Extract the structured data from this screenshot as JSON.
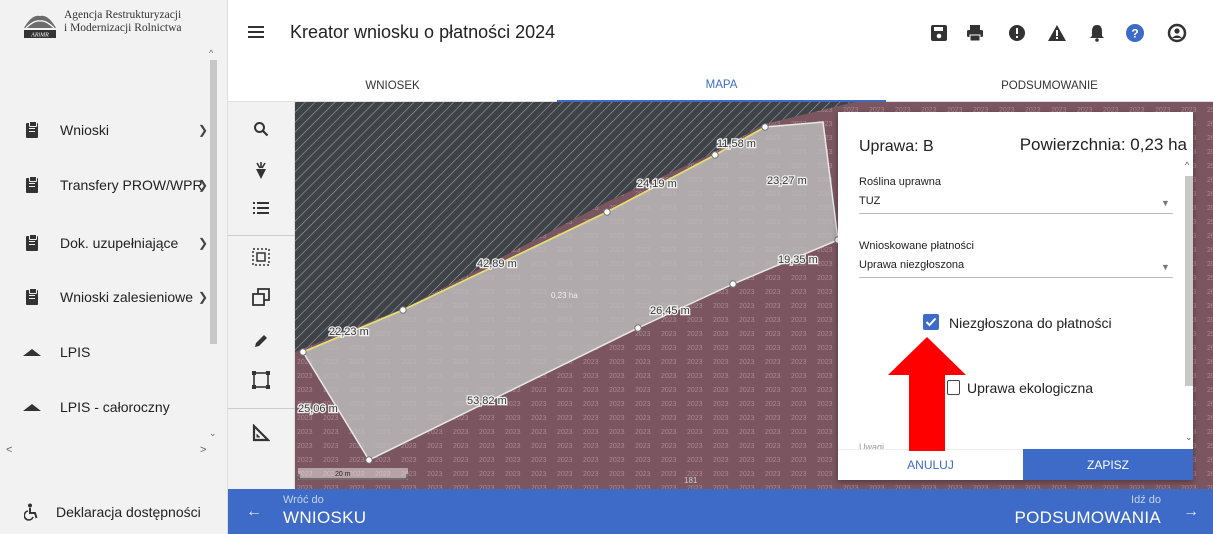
{
  "logo": {
    "line1": "Agencja Restrukturyzacji",
    "line2": "i Modernizacji Rolnictwa",
    "mark": "ARiMR"
  },
  "header": {
    "title": "Kreator wniosku o płatności 2024"
  },
  "tabs": [
    {
      "label": "WNIOSEK"
    },
    {
      "label": "MAPA"
    },
    {
      "label": "PODSUMOWANIE"
    }
  ],
  "active_tab": "MAPA",
  "sidebar": {
    "items": [
      {
        "label": "Wnioski",
        "icon": "clipboard-icon",
        "chevron": "⌄"
      },
      {
        "label": "Transfery PROW/WPR",
        "icon": "clipboard-icon",
        "chevron": "⌄"
      },
      {
        "label": "Dok. uzupełniające",
        "icon": "clipboard-icon",
        "chevron": "⌄"
      },
      {
        "label": "Wnioski zalesieniowe",
        "icon": "clipboard-icon",
        "chevron": "⌄"
      },
      {
        "label": "LPIS",
        "icon": "mountain-icon"
      },
      {
        "label": "LPIS - całoroczny",
        "icon": "mountain-icon"
      }
    ],
    "footer": {
      "label": "Deklaracja dostępności",
      "icon": "accessibility-icon"
    }
  },
  "toolbar_icons": [
    "search-icon",
    "beet-icon",
    "list-icon",
    "select-area-icon",
    "layers-icon",
    "pencil-icon",
    "crop-icon",
    "ruler-icon"
  ],
  "header_icons": [
    "save-icon",
    "print-icon",
    "alert-circle-icon",
    "warning-icon",
    "bell-icon",
    "help-icon",
    "account-icon"
  ],
  "map": {
    "labels": [
      "11,58 m",
      "23,27 m",
      "24,19 m",
      "42,89 m",
      "19,35 m",
      "26,45 m",
      "22,23 m",
      "25,06 m",
      "53,82 m",
      "0,23 ha",
      "181"
    ],
    "scale": "20 m",
    "year_pattern": "2023"
  },
  "panel": {
    "title": "Uprawa: B",
    "area": "Powierzchnia: 0,23 ha",
    "field1_label": "Roślina uprawna",
    "field1_value": "TUZ",
    "field2_label": "Wnioskowane płatności",
    "field2_value": "Uprawa niezgłoszona",
    "checkbox1": {
      "label": "Niezgłoszona do płatności",
      "checked": true
    },
    "checkbox2": {
      "label": "Uprawa ekologiczna",
      "checked": false
    },
    "truncated_label": "Uwagi",
    "cancel": "ANULUJ",
    "save": "ZAPISZ"
  },
  "footer_nav": {
    "back_small": "Wróć do",
    "back_big": "WNIOSKU",
    "forward_small": "Idź do",
    "forward_big": "PODSUMOWANIA"
  },
  "colors": {
    "accent": "#3d6bc7",
    "arrow": "#ff0000",
    "sidebar": "#f2f2f2"
  }
}
